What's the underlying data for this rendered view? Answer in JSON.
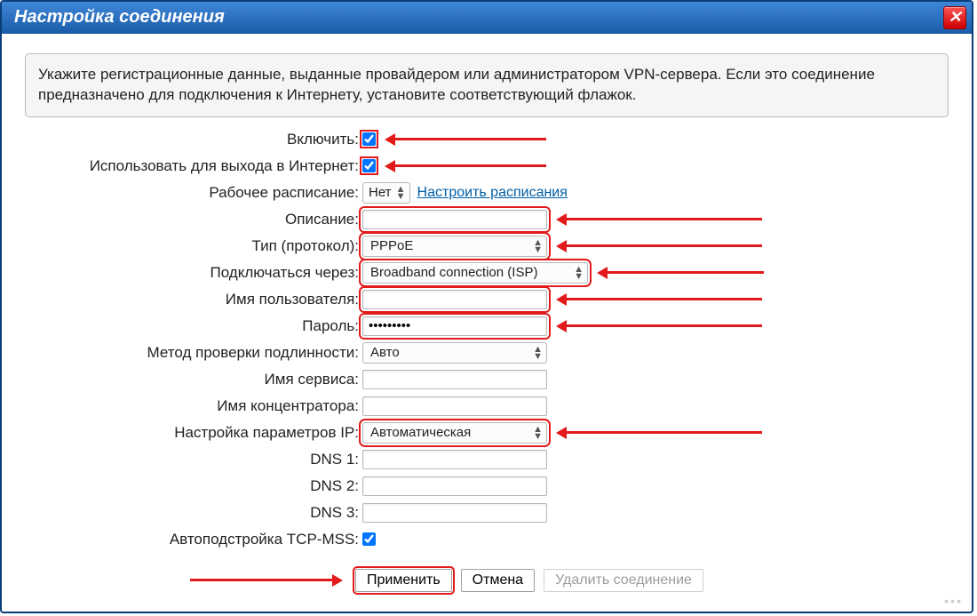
{
  "window": {
    "title": "Настройка соединения"
  },
  "info": "Укажите регистрационные данные, выданные провайдером или администратором VPN-сервера. Если это соединение предназначено для подключения к Интернету, установите соответствующий флажок.",
  "labels": {
    "enable": "Включить:",
    "use_internet": "Использовать для выхода в Интернет:",
    "schedule": "Рабочее расписание:",
    "schedule_link": "Настроить расписания",
    "description": "Описание:",
    "protocol": "Тип (протокол):",
    "connect_via": "Подключаться через:",
    "username": "Имя пользователя:",
    "password": "Пароль:",
    "auth_method": "Метод проверки подлинности:",
    "service_name": "Имя сервиса:",
    "concentrator": "Имя концентратора:",
    "ip_setup": "Настройка параметров IP:",
    "dns1": "DNS 1:",
    "dns2": "DNS 2:",
    "dns3": "DNS 3:",
    "tcp_mss": "Автоподстройка TCP-MSS:"
  },
  "values": {
    "schedule": "Нет",
    "description": "",
    "protocol": "PPPoE",
    "connect_via": "Broadband connection (ISP)",
    "username": "",
    "password": "•••••••••",
    "auth_method": "Авто",
    "service_name": "",
    "concentrator": "",
    "ip_setup": "Автоматическая",
    "dns1": "",
    "dns2": "",
    "dns3": ""
  },
  "checks": {
    "enable": true,
    "use_internet": true,
    "tcp_mss": true
  },
  "buttons": {
    "apply": "Применить",
    "cancel": "Отмена",
    "delete": "Удалить соединение"
  }
}
